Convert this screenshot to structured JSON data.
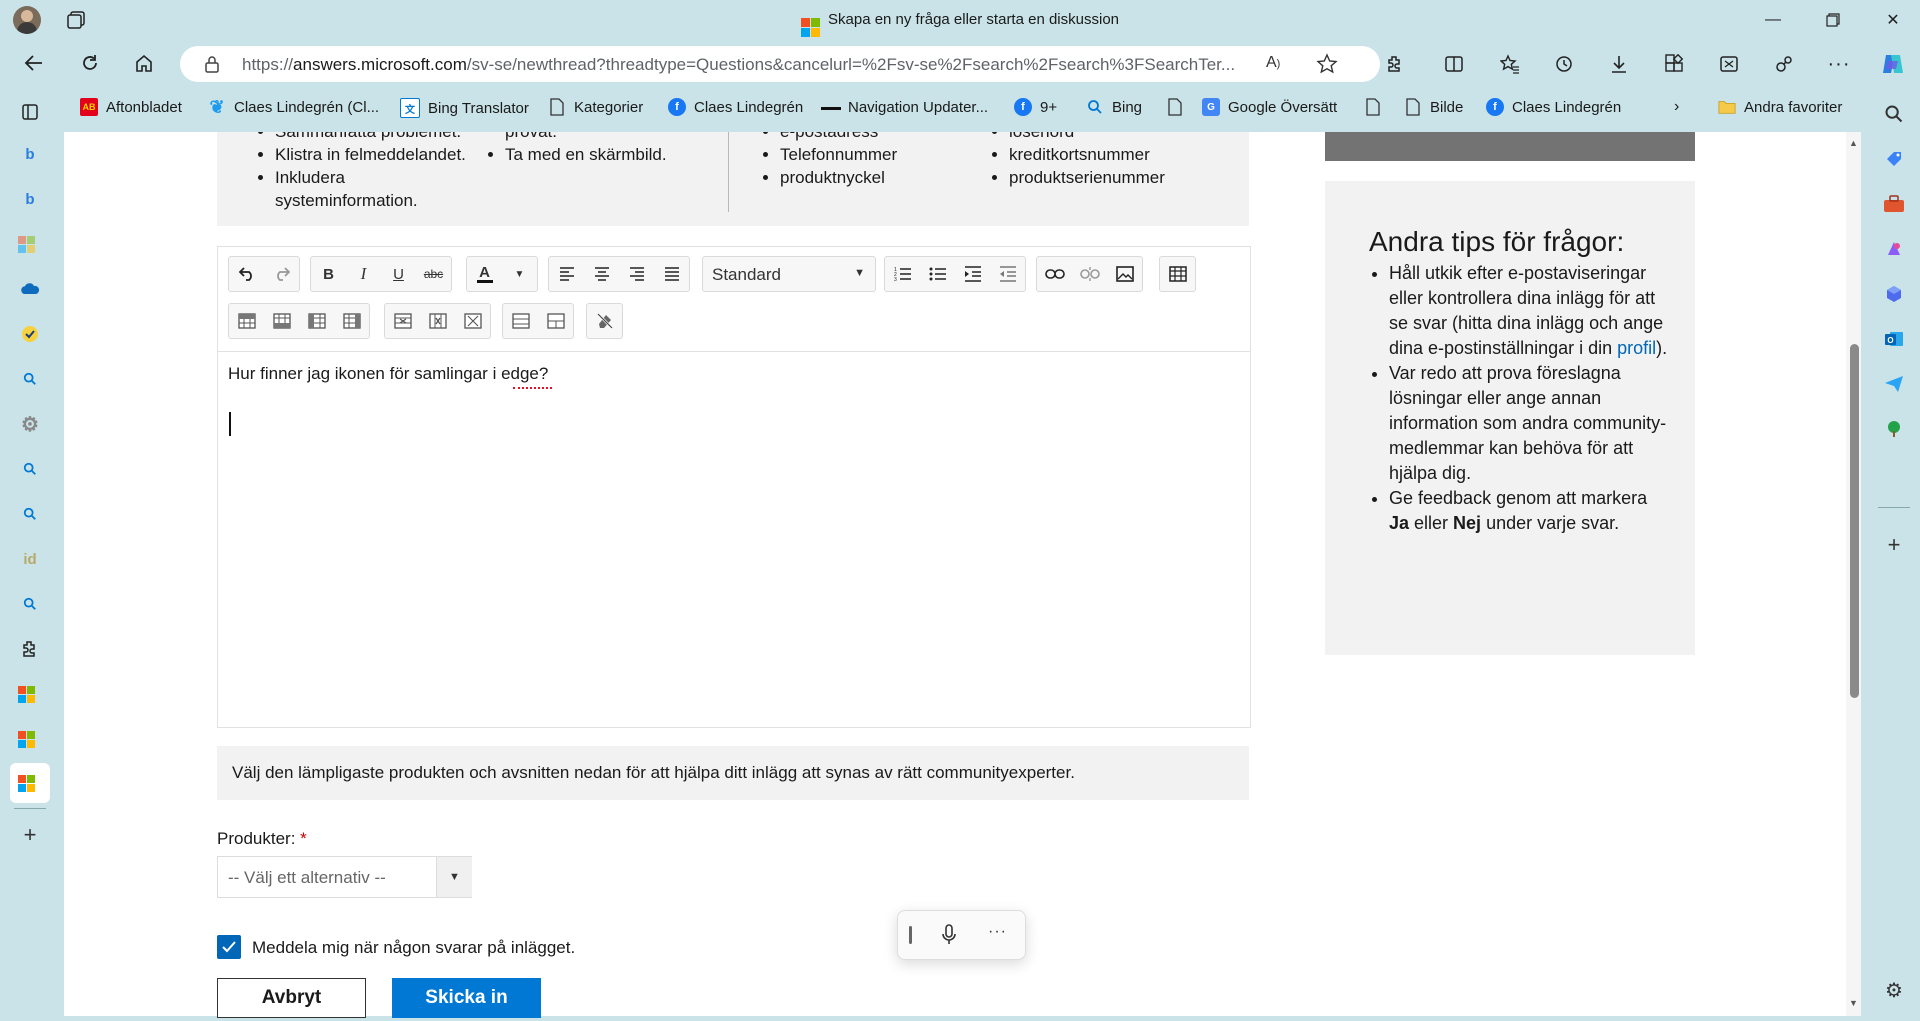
{
  "window": {
    "title": "Skapa en ny fråga eller starta en diskussion"
  },
  "address": {
    "url_prefix": "https://",
    "url_host": "answers.microsoft.com",
    "url_rest": "/sv-se/newthread?threadtype=Questions&cancelurl=%2Fsv-se%2Fsearch%2Fsearch%3FSearchTer..."
  },
  "favorites": {
    "items": [
      "Aftonbladet",
      "Claes Lindegrén (Cl...",
      "Bing Translator",
      "Kategorier",
      "Claes Lindegrén",
      "Navigation Updater...",
      "9+",
      "Bing",
      "Google Översätt",
      "Bilde",
      "Claes Lindegrén"
    ],
    "other": "Andra favoriter"
  },
  "tips_top": {
    "col1": [
      "Sammanfatta problemet.",
      "Klistra in felmeddelandet.",
      "Inkludera systeminformation."
    ],
    "col2": [
      "provat.",
      "Ta med en skärmbild."
    ],
    "col3": [
      "e-postadress",
      "Telefonnummer",
      "produktnyckel"
    ],
    "col4": [
      "lösenord",
      "kreditkortsnummer",
      "produktserienummer"
    ]
  },
  "editor": {
    "format_select": "Standard",
    "content": "Hur finner jag ikonen för samlingar i edge?"
  },
  "info_bar": "Välj den lämpligaste produkten och avsnitten nedan för att hjälpa ditt inlägg att synas av rätt communityexperter.",
  "products": {
    "label": "Produkter:",
    "required_mark": "*",
    "placeholder": "-- Välj ett alternativ --"
  },
  "notify": {
    "label": "Meddela mig när någon svarar på inlägget.",
    "checked": true
  },
  "buttons": {
    "cancel": "Avbryt",
    "submit": "Skicka in"
  },
  "side_tips": {
    "title": "Andra tips för frågor:",
    "item1_text": "Håll utkik efter e-postaviseringar eller kontrollera dina inlägg för att se svar (hitta dina inlägg och ange dina e-postinställningar i din ",
    "item1_link": "profil",
    "item1_end": ").",
    "item2": "Var redo att prova föreslagna lösningar eller ange annan information som andra community-medlemmar kan behöva för att hjälpa dig.",
    "item3_a": "Ge feedback genom att markera ",
    "item3_yes": "Ja",
    "item3_b": " eller ",
    "item3_no": "Nej",
    "item3_c": " under varje svar."
  },
  "colors": {
    "accent": "#0078d4",
    "frame": "#c9e3e8",
    "panel": "#f2f2f2"
  }
}
